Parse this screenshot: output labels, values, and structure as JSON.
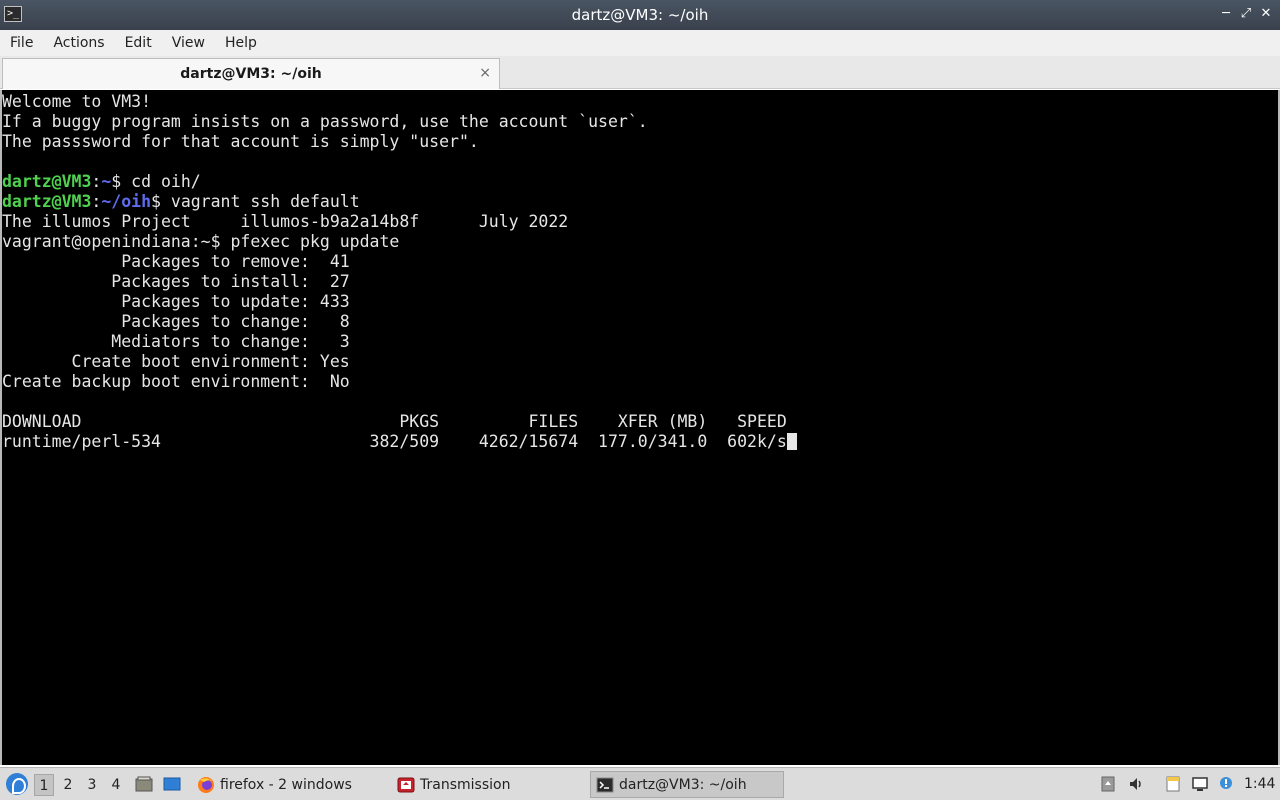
{
  "window": {
    "title": "dartz@VM3: ~/oih"
  },
  "menu": [
    "File",
    "Actions",
    "Edit",
    "View",
    "Help"
  ],
  "tab": {
    "label": "dartz@VM3: ~/oih",
    "close_glyph": "×"
  },
  "terminal": {
    "lines": [
      {
        "segments": [
          {
            "text": "Welcome to VM3!",
            "style": "plain"
          }
        ]
      },
      {
        "segments": [
          {
            "text": "If a buggy program insists on a password, use the account `user`.",
            "style": "plain"
          }
        ]
      },
      {
        "segments": [
          {
            "text": "The passsword for that account is simply \"user\".",
            "style": "plain"
          }
        ]
      },
      {
        "segments": [
          {
            "text": "",
            "style": "plain"
          }
        ]
      },
      {
        "segments": [
          {
            "text": "dartz@VM3",
            "style": "green"
          },
          {
            "text": ":",
            "style": "plain"
          },
          {
            "text": "~",
            "style": "blue"
          },
          {
            "text": "$ cd oih/",
            "style": "plain"
          }
        ]
      },
      {
        "segments": [
          {
            "text": "dartz@VM3",
            "style": "green"
          },
          {
            "text": ":",
            "style": "plain"
          },
          {
            "text": "~/oih",
            "style": "blue"
          },
          {
            "text": "$ vagrant ssh default",
            "style": "plain"
          }
        ]
      },
      {
        "segments": [
          {
            "text": "The illumos Project     illumos-b9a2a14b8f      July 2022",
            "style": "plain"
          }
        ]
      },
      {
        "segments": [
          {
            "text": "vagrant@openindiana:~$ pfexec pkg update",
            "style": "plain"
          }
        ]
      },
      {
        "segments": [
          {
            "text": "            Packages to remove:  41",
            "style": "plain"
          }
        ]
      },
      {
        "segments": [
          {
            "text": "           Packages to install:  27",
            "style": "plain"
          }
        ]
      },
      {
        "segments": [
          {
            "text": "            Packages to update: 433",
            "style": "plain"
          }
        ]
      },
      {
        "segments": [
          {
            "text": "            Packages to change:   8",
            "style": "plain"
          }
        ]
      },
      {
        "segments": [
          {
            "text": "           Mediators to change:   3",
            "style": "plain"
          }
        ]
      },
      {
        "segments": [
          {
            "text": "       Create boot environment: Yes",
            "style": "plain"
          }
        ]
      },
      {
        "segments": [
          {
            "text": "Create backup boot environment:  No",
            "style": "plain"
          }
        ]
      },
      {
        "segments": [
          {
            "text": "",
            "style": "plain"
          }
        ]
      },
      {
        "segments": [
          {
            "text": "DOWNLOAD                                PKGS         FILES    XFER (MB)   SPEED",
            "style": "plain"
          }
        ]
      },
      {
        "segments": [
          {
            "text": "runtime/perl-534                     382/509    4262/15674  177.0/341.0  602k/s",
            "style": "plain"
          }
        ],
        "cursor": true
      }
    ]
  },
  "taskbar": {
    "workspaces": [
      "1",
      "2",
      "3",
      "4"
    ],
    "tasks": [
      {
        "label": "firefox - 2 windows",
        "icon": "firefox-icon",
        "active": false
      },
      {
        "label": "Transmission",
        "icon": "transmission-icon",
        "active": false
      },
      {
        "label": "dartz@VM3: ~/oih",
        "icon": "terminal-icon",
        "active": true
      }
    ],
    "clock": "1:44"
  },
  "colors": {
    "prompt_user": "#4fd34f",
    "prompt_path": "#5f6cf0",
    "terminal_bg": "#000000",
    "terminal_fg": "#e6e6e6"
  }
}
